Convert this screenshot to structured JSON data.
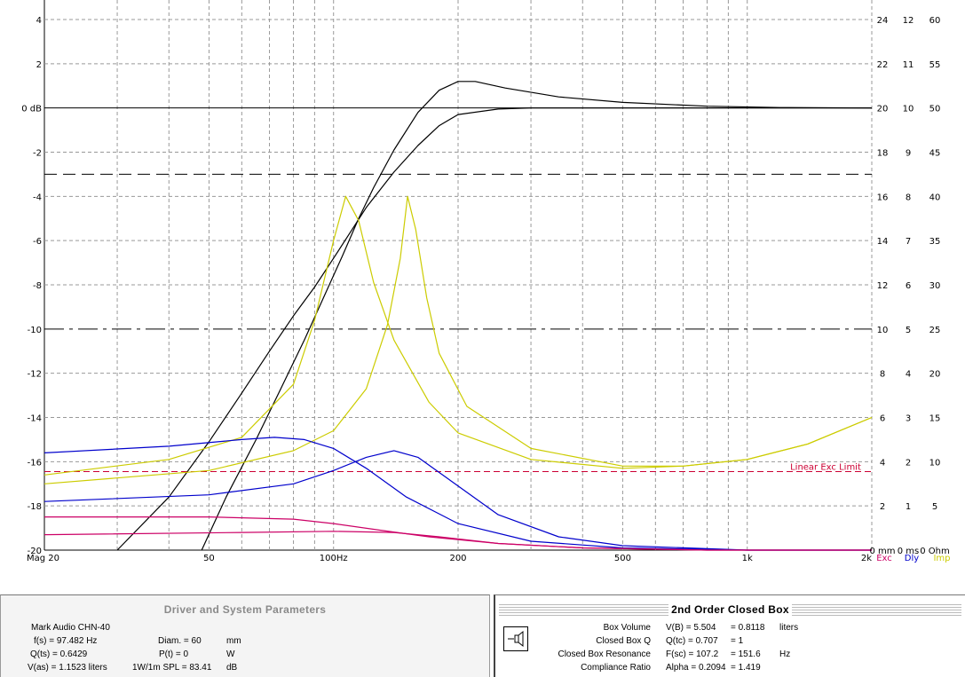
{
  "chart_data": {
    "type": "line",
    "x_scale": "log",
    "xlim": [
      20,
      2000
    ],
    "ylim": [
      -20,
      4
    ],
    "y_ticks": [
      "4",
      "2",
      "0 dB",
      "-2",
      "-4",
      "-6",
      "-8",
      "-10",
      "-12",
      "-14",
      "-16",
      "-18",
      "-20"
    ],
    "x_ticks": [
      {
        "value": 20,
        "label": "Mag 20"
      },
      {
        "value": 50,
        "label": "50"
      },
      {
        "value": 100,
        "label": "100Hz"
      },
      {
        "value": 200,
        "label": "200"
      },
      {
        "value": 500,
        "label": "500"
      },
      {
        "value": 1000,
        "label": "1k"
      },
      {
        "value": 2000,
        "label": "2k"
      }
    ],
    "right_axis_1": [
      "24",
      "22",
      "20",
      "18",
      "16",
      "14",
      "12",
      "10",
      "8",
      "6",
      "4",
      "2",
      "0 mm"
    ],
    "right_axis_2": [
      "12",
      "11",
      "10",
      "9",
      "8",
      "7",
      "6",
      "5",
      "4",
      "3",
      "2",
      "1",
      "0 ms"
    ],
    "right_axis_3": [
      "60",
      "55",
      "50",
      "45",
      "40",
      "35",
      "30",
      "25",
      "20",
      "15",
      "10",
      "5",
      "0 Ohm"
    ],
    "legend": [
      {
        "label": "Exc",
        "color": "#cc0066"
      },
      {
        "label": "Dly",
        "color": "#0000cc"
      },
      {
        "label": "Imp",
        "color": "#cccc00"
      }
    ],
    "annotation": {
      "text": "Linear Exc Limit",
      "y": -16.45,
      "color": "#cc0033"
    },
    "reference_lines": [
      {
        "y": -3,
        "style": "dashed"
      },
      {
        "y": -10,
        "style": "dashdot"
      },
      {
        "y": 0,
        "style": "solid"
      }
    ],
    "series": [
      {
        "color": "#000000",
        "points": [
          [
            30,
            -20
          ],
          [
            40,
            -17.6
          ],
          [
            50,
            -15.1
          ],
          [
            60,
            -12.9
          ],
          [
            70,
            -11.0
          ],
          [
            80,
            -9.4
          ],
          [
            90,
            -8.1
          ],
          [
            100,
            -6.8
          ],
          [
            110,
            -5.6
          ],
          [
            120,
            -4.5
          ],
          [
            140,
            -2.9
          ],
          [
            160,
            -1.7
          ],
          [
            180,
            -0.8
          ],
          [
            200,
            -0.3
          ],
          [
            250,
            -0.05
          ],
          [
            300,
            0
          ],
          [
            1000,
            0
          ],
          [
            2000,
            0
          ]
        ]
      },
      {
        "color": "#000000",
        "points": [
          [
            48,
            -20
          ],
          [
            55,
            -17.6
          ],
          [
            65,
            -15.0
          ],
          [
            75,
            -12.6
          ],
          [
            85,
            -10.5
          ],
          [
            95,
            -8.5
          ],
          [
            105,
            -6.7
          ],
          [
            115,
            -5.0
          ],
          [
            125,
            -3.6
          ],
          [
            140,
            -1.9
          ],
          [
            160,
            -0.2
          ],
          [
            180,
            0.8
          ],
          [
            200,
            1.2
          ],
          [
            220,
            1.2
          ],
          [
            260,
            0.9
          ],
          [
            350,
            0.5
          ],
          [
            500,
            0.25
          ],
          [
            800,
            0.08
          ],
          [
            1200,
            0.02
          ],
          [
            2000,
            0
          ]
        ]
      },
      {
        "color": "#cccc00",
        "points": [
          [
            20,
            -16.6
          ],
          [
            40,
            -15.9
          ],
          [
            60,
            -14.9
          ],
          [
            80,
            -12.5
          ],
          [
            90,
            -9.6
          ],
          [
            100,
            -6.0
          ],
          [
            107,
            -4.0
          ],
          [
            115,
            -5.1
          ],
          [
            125,
            -7.9
          ],
          [
            140,
            -10.5
          ],
          [
            170,
            -13.3
          ],
          [
            200,
            -14.7
          ],
          [
            300,
            -15.9
          ],
          [
            500,
            -16.3
          ],
          [
            700,
            -16.2
          ],
          [
            1000,
            -15.9
          ],
          [
            1400,
            -15.2
          ],
          [
            2000,
            -14.0
          ]
        ]
      },
      {
        "color": "#cccc00",
        "points": [
          [
            20,
            -17.0
          ],
          [
            50,
            -16.4
          ],
          [
            80,
            -15.5
          ],
          [
            100,
            -14.6
          ],
          [
            120,
            -12.7
          ],
          [
            135,
            -9.8
          ],
          [
            145,
            -6.8
          ],
          [
            151,
            -4.0
          ],
          [
            158,
            -5.5
          ],
          [
            168,
            -8.6
          ],
          [
            180,
            -11.1
          ],
          [
            210,
            -13.5
          ],
          [
            300,
            -15.4
          ],
          [
            500,
            -16.2
          ],
          [
            700,
            -16.2
          ],
          [
            1000,
            -15.9
          ],
          [
            1400,
            -15.2
          ],
          [
            2000,
            -14.0
          ]
        ]
      },
      {
        "color": "#0000cc",
        "points": [
          [
            20,
            -15.6
          ],
          [
            40,
            -15.3
          ],
          [
            60,
            -15.0
          ],
          [
            72,
            -14.9
          ],
          [
            85,
            -15.0
          ],
          [
            100,
            -15.4
          ],
          [
            120,
            -16.3
          ],
          [
            150,
            -17.6
          ],
          [
            200,
            -18.8
          ],
          [
            300,
            -19.6
          ],
          [
            500,
            -19.9
          ],
          [
            1000,
            -20
          ],
          [
            2000,
            -20
          ]
        ]
      },
      {
        "color": "#0000cc",
        "points": [
          [
            20,
            -17.8
          ],
          [
            50,
            -17.5
          ],
          [
            80,
            -17.0
          ],
          [
            100,
            -16.4
          ],
          [
            120,
            -15.8
          ],
          [
            140,
            -15.5
          ],
          [
            160,
            -15.8
          ],
          [
            190,
            -16.8
          ],
          [
            250,
            -18.4
          ],
          [
            350,
            -19.4
          ],
          [
            500,
            -19.8
          ],
          [
            1000,
            -20
          ],
          [
            2000,
            -20
          ]
        ]
      },
      {
        "color": "#cc0066",
        "points": [
          [
            20,
            -18.5
          ],
          [
            50,
            -18.5
          ],
          [
            80,
            -18.6
          ],
          [
            100,
            -18.8
          ],
          [
            130,
            -19.1
          ],
          [
            170,
            -19.4
          ],
          [
            250,
            -19.7
          ],
          [
            400,
            -19.9
          ],
          [
            800,
            -20
          ],
          [
            2000,
            -20
          ]
        ]
      },
      {
        "color": "#cc0066",
        "points": [
          [
            20,
            -19.3
          ],
          [
            60,
            -19.2
          ],
          [
            100,
            -19.15
          ],
          [
            140,
            -19.2
          ],
          [
            180,
            -19.4
          ],
          [
            250,
            -19.7
          ],
          [
            400,
            -19.9
          ],
          [
            800,
            -20
          ],
          [
            2000,
            -20
          ]
        ]
      }
    ]
  },
  "driver_panel": {
    "title": "Driver and System Parameters",
    "driver_name": "Mark Audio CHN-40",
    "fs": "f(s) = 97.482 Hz",
    "qts": "Q(ts) = 0.6429",
    "vas": "V(as) = 1.1523 liters",
    "diam_label": "Diam. = 60",
    "diam_unit": "mm",
    "pt_label": "P(t) = 0",
    "pt_unit": "W",
    "spl_label": "1W/1m SPL = 83.41",
    "spl_unit": "dB"
  },
  "box_panel": {
    "title": "2nd Order Closed Box",
    "rows": [
      {
        "label": "Box Volume",
        "value": "V(B) = 5.504",
        "value2": "= 0.8118",
        "unit": "liters"
      },
      {
        "label": "Closed Box Q",
        "value": "Q(tc) = 0.707",
        "value2": "= 1",
        "unit": ""
      },
      {
        "label": "Closed Box Resonance",
        "value": "F(sc) = 107.2",
        "value2": "= 151.6",
        "unit": "Hz"
      },
      {
        "label": "Compliance Ratio",
        "value": "Alpha = 0.2094",
        "value2": "= 1.419",
        "unit": ""
      }
    ]
  }
}
